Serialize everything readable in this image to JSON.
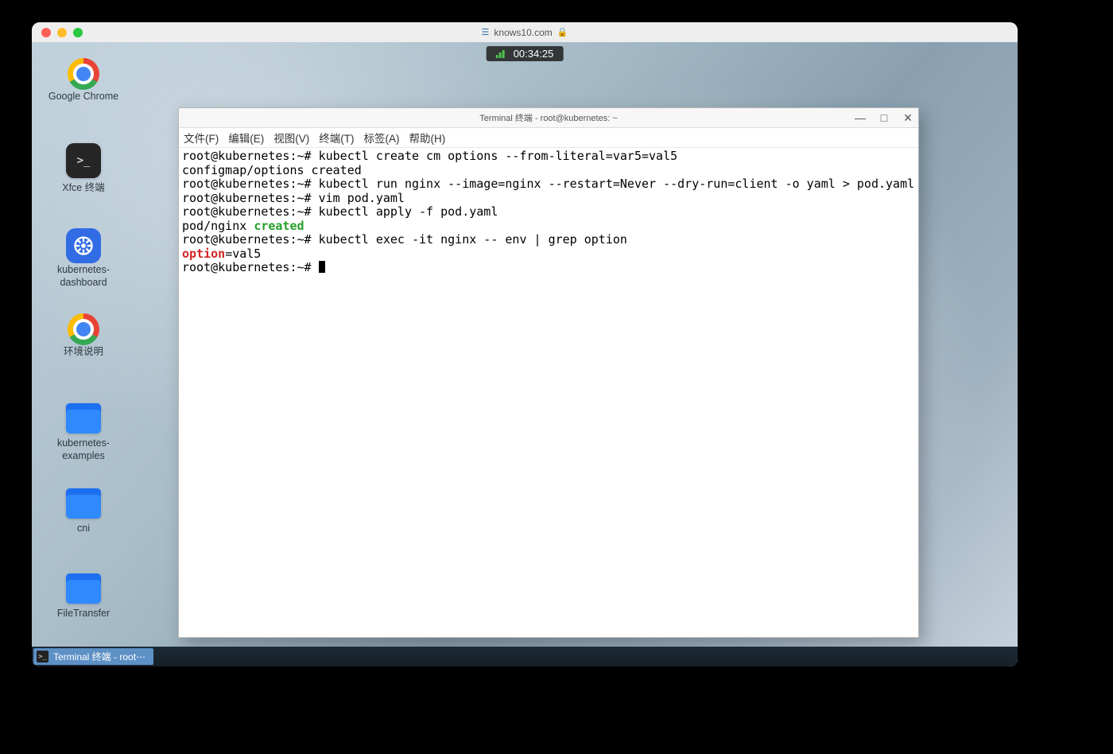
{
  "mac_title": "knows10.com",
  "timer": "00:34:25",
  "desktop_icons": {
    "chrome": "Google Chrome",
    "xfce": "Xfce 终端",
    "k8sdash": "kubernetes-\ndashboard",
    "env": "环境说明",
    "examples": "kubernetes-\nexamples",
    "cni": "cni",
    "ft": "FileTransfer"
  },
  "taskbar_btn": "Terminal 终端 - root⋯",
  "terminal": {
    "title": "Terminal 终端 - root@kubernetes: ~",
    "menus": {
      "file": "文件(F)",
      "edit": "编辑(E)",
      "view": "视图(V)",
      "terminal": "终端(T)",
      "tabs": "标签(A)",
      "help": "帮助(H)"
    },
    "prompt": "root@kubernetes:~# ",
    "lines": {
      "l1_cmd": "kubectl create cm options --from-literal=var5=val5",
      "l2": "configmap/options created",
      "l3_cmd": "kubectl run nginx --image=nginx --restart=Never --dry-run=client -o yaml > pod.yaml",
      "l4_cmd": "vim pod.yaml",
      "l5_cmd": "kubectl apply -f pod.yaml",
      "l6_a": "pod/nginx ",
      "l6_b": "created",
      "l7_cmd": "kubectl exec -it nginx -- env | grep option",
      "l8_a": "option",
      "l8_b": "=val5"
    }
  }
}
